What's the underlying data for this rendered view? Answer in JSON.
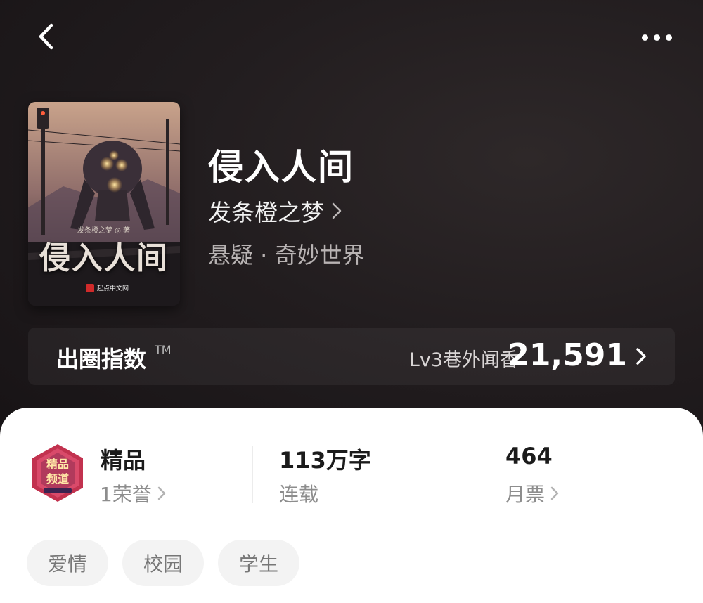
{
  "nav": {
    "back_icon": "chevron-left-icon",
    "more_icon": "more-horizontal-icon"
  },
  "cover": {
    "title": "侵入人间",
    "author_line": "发条橙之梦 ◎ 著",
    "publisher": "起点中文网"
  },
  "book": {
    "title": "侵入人间",
    "author": "发条橙之梦",
    "genre": "悬疑 · 奇妙世界"
  },
  "index": {
    "label": "出圈指数",
    "tm": "TM",
    "level": "Lv3巷外闻香",
    "score": "21,591"
  },
  "stats": {
    "quality": {
      "title": "精品",
      "sub": "1荣誉",
      "badge_text": "精品频道"
    },
    "words": {
      "title": "113万字",
      "sub": "连载"
    },
    "votes": {
      "title": "464",
      "sub": "月票"
    }
  },
  "tags": [
    "爱情",
    "校园",
    "学生"
  ],
  "colors": {
    "hero_bg": "#1e1a1c",
    "sheet_bg": "#ffffff",
    "tag_bg": "#f3f3f3",
    "badge_red": "#c2324f"
  }
}
